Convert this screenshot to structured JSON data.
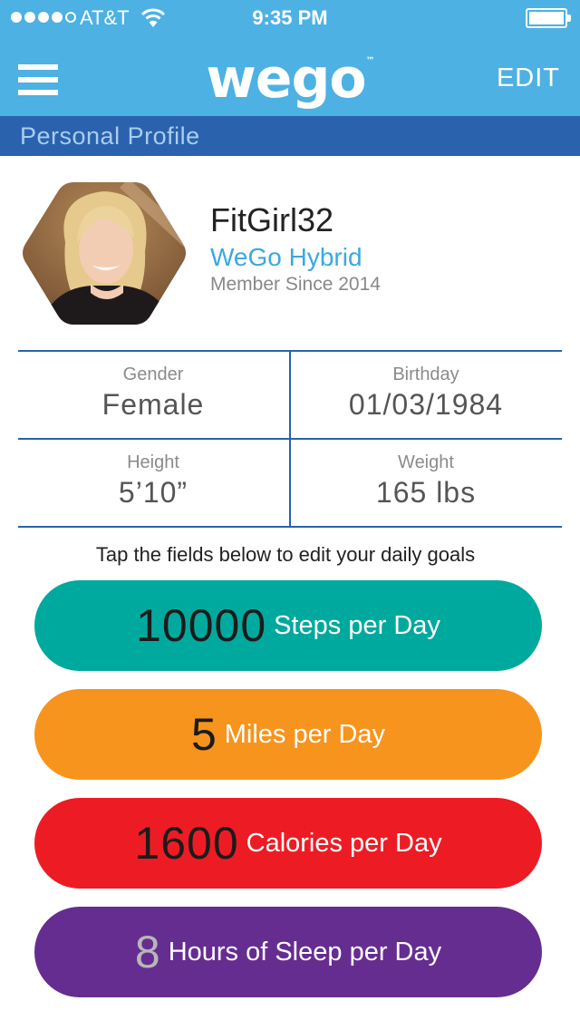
{
  "status_bar": {
    "carrier": "AT&T",
    "time": "9:35 PM"
  },
  "header": {
    "logo": "wego",
    "logo_mark": "™",
    "edit_label": "EDIT",
    "section_title": "Personal Profile"
  },
  "profile": {
    "username": "FitGirl32",
    "device": "WeGo Hybrid",
    "member_since": "Member Since 2014"
  },
  "details": {
    "gender_label": "Gender",
    "gender_value": "Female",
    "birthday_label": "Birthday",
    "birthday_value": "01/03/1984",
    "height_label": "Height",
    "height_value": "5’10”",
    "weight_label": "Weight",
    "weight_value": "165 lbs"
  },
  "goals": {
    "hint": "Tap the fields below to edit your daily goals",
    "items": [
      {
        "value": "10000",
        "unit": "Steps per Day",
        "color": "#00a99d"
      },
      {
        "value": "5",
        "unit": "Miles per Day",
        "color": "#f7941d"
      },
      {
        "value": "1600",
        "unit": "Calories per Day",
        "color": "#ed1c24"
      },
      {
        "value": "8",
        "unit": "Hours of Sleep per Day",
        "color": "#662d91"
      }
    ]
  },
  "colors": {
    "header_blue": "#4db1e3",
    "section_blue": "#2a62ad",
    "accent_text": "#3aa9e0"
  }
}
